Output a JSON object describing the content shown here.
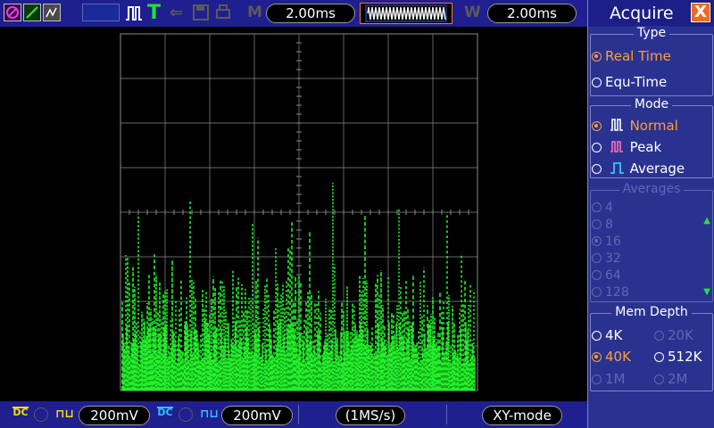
{
  "top_bar": {
    "icons": [
      "channel-icon",
      "edit-icon",
      "display-icon",
      "empty-slot",
      "pulse-trigger-icon",
      "trigger-t-icon",
      "probe-icon",
      "save-icon",
      "print-icon"
    ],
    "m_label": "M",
    "timebase": "2.00ms",
    "w_label": "W",
    "window_timebase": "2.00ms"
  },
  "bottom_bar": {
    "ch1_coupling": "DC",
    "ch1_scale": "200mV",
    "ch2_coupling": "DC",
    "ch2_scale": "200mV",
    "sample_rate": "(1MS/s)",
    "mode": "XY-mode"
  },
  "colors": {
    "trace": "#22f02a",
    "grid": "#8a8a8a",
    "accent_orange": "#f5a040",
    "panel_bg": "#2a3290",
    "bar_bg": "#1f1f8f"
  },
  "panel": {
    "title": "Acquire",
    "close_label": "X",
    "type": {
      "heading": "Type",
      "options": [
        {
          "label": "Real Time",
          "selected": true
        },
        {
          "label": "Equ-Time",
          "selected": false
        }
      ]
    },
    "mode": {
      "heading": "Mode",
      "options": [
        {
          "label": "Normal",
          "selected": true,
          "icon": "normal-waveform-icon"
        },
        {
          "label": "Peak",
          "selected": false,
          "icon": "peak-waveform-icon"
        },
        {
          "label": "Average",
          "selected": false,
          "icon": "average-waveform-icon"
        }
      ]
    },
    "averages": {
      "heading": "Averages",
      "options": [
        {
          "label": "4",
          "selected": false
        },
        {
          "label": "8",
          "selected": false
        },
        {
          "label": "16",
          "selected": true
        },
        {
          "label": "32",
          "selected": false
        },
        {
          "label": "64",
          "selected": false
        },
        {
          "label": "128",
          "selected": false
        }
      ]
    },
    "mem_depth": {
      "heading": "Mem Depth",
      "options": [
        {
          "label": "4K",
          "selected": false
        },
        {
          "label": "20K",
          "selected": false
        },
        {
          "label": "40K",
          "selected": true
        },
        {
          "label": "512K",
          "selected": false
        },
        {
          "label": "1M",
          "selected": false
        },
        {
          "label": "2M",
          "selected": false
        }
      ]
    }
  }
}
